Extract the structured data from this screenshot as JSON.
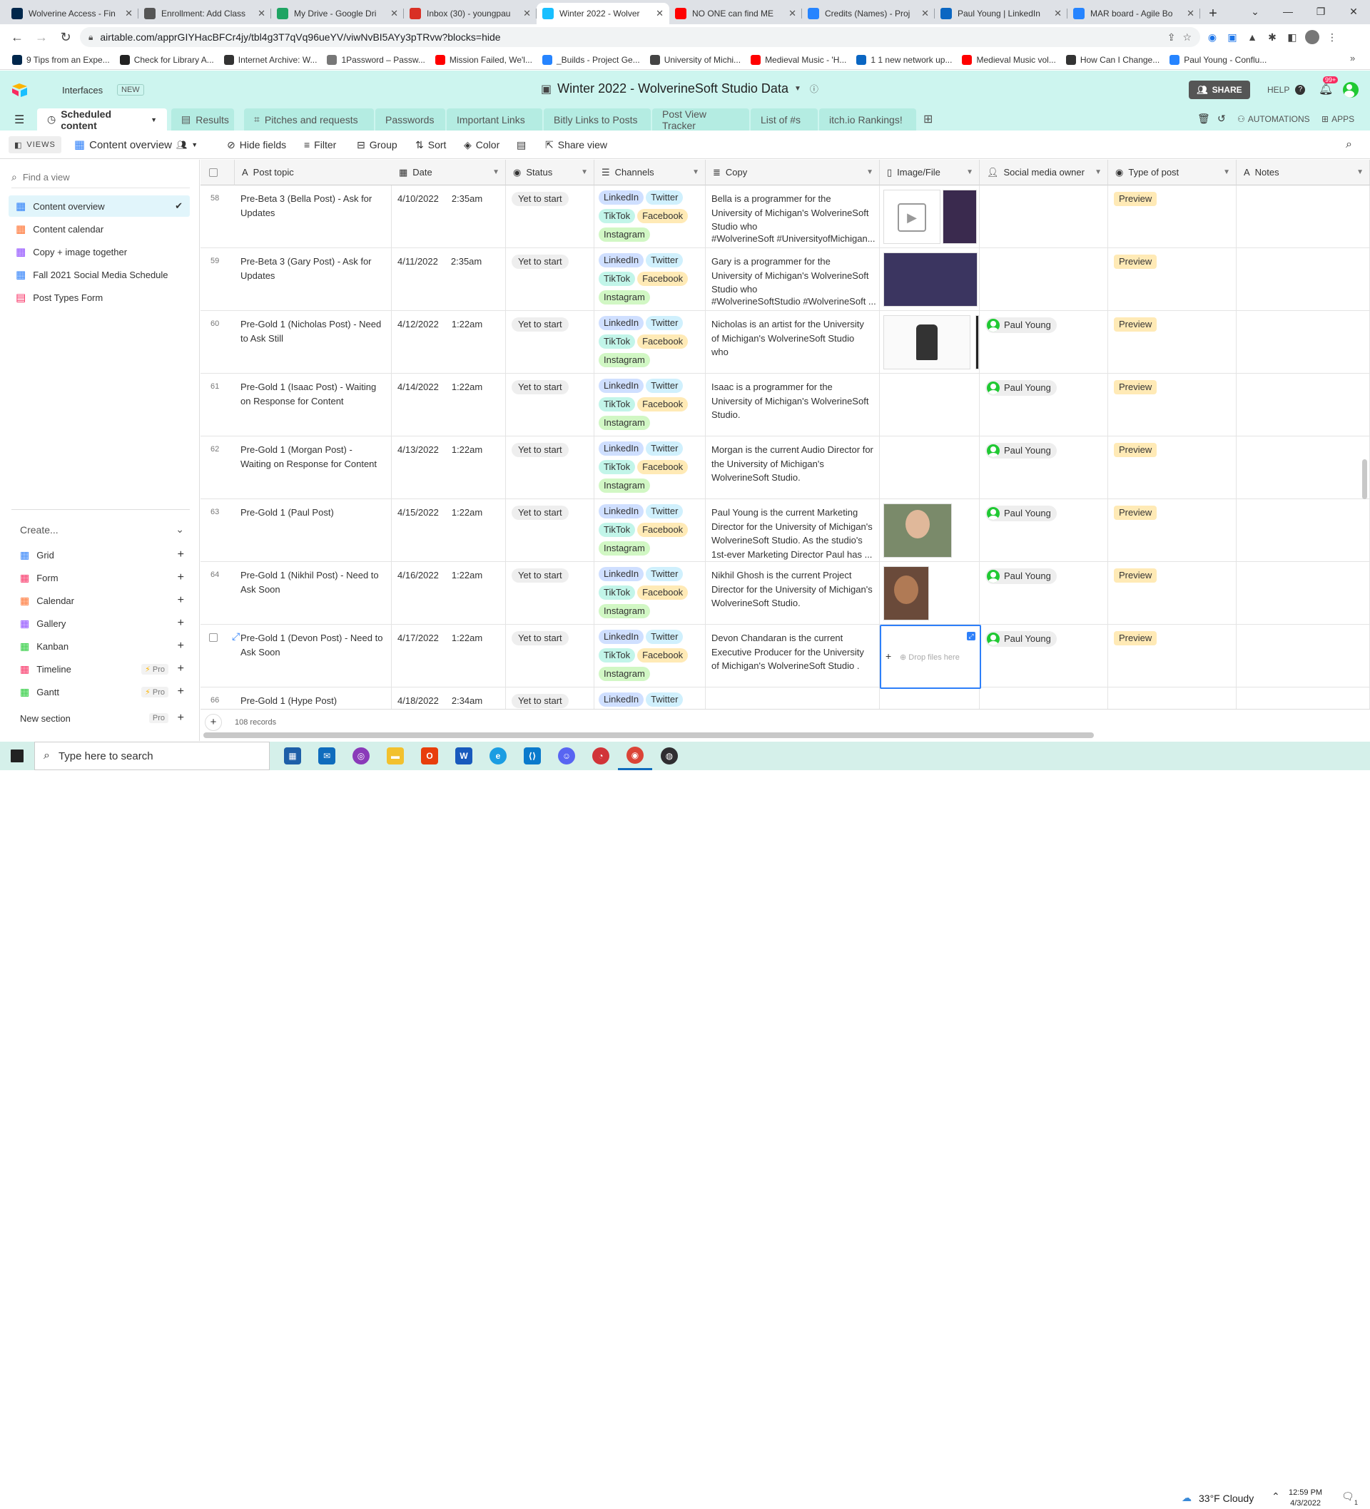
{
  "browser": {
    "tabs": [
      {
        "title": "Wolverine Access - Fin",
        "icon": "michigan-icon",
        "color": "#00274c"
      },
      {
        "title": "Enrollment: Add Class",
        "icon": "globe-icon",
        "color": "#555555"
      },
      {
        "title": "My Drive - Google Dri",
        "icon": "drive-icon",
        "color": "#1fa463"
      },
      {
        "title": "Inbox (30) - youngpau",
        "icon": "gmail-icon",
        "color": "#d93025"
      },
      {
        "title": "Winter 2022 - Wolver",
        "icon": "airtable-icon",
        "color": "#18bfff"
      },
      {
        "title": "NO ONE can find ME",
        "icon": "youtube-icon",
        "color": "#ff0000"
      },
      {
        "title": "Credits (Names) - Proj",
        "icon": "confluence-icon",
        "color": "#2684ff"
      },
      {
        "title": "Paul Young | LinkedIn",
        "icon": "linkedin-icon",
        "color": "#0a66c2"
      },
      {
        "title": "MAR board - Agile Bo",
        "icon": "jira-icon",
        "color": "#2684ff"
      }
    ],
    "url": "airtable.com/apprGIYHacBFCr4jy/tbl4g3T7qVq96ueYV/viwNvBI5AYy3pTRvw?blocks=hide",
    "bookmarks": [
      {
        "label": "9 Tips from an Expe...",
        "icon": "michigan-icon",
        "color": "#00274c"
      },
      {
        "label": "Check for Library A...",
        "icon": "library-icon",
        "color": "#222222"
      },
      {
        "label": "Internet Archive: W...",
        "icon": "archive-icon",
        "color": "#333333"
      },
      {
        "label": "1Password – Passw...",
        "icon": "1password-icon",
        "color": "#777777"
      },
      {
        "label": "Mission Failed, We'l...",
        "icon": "youtube-icon",
        "color": "#ff0000"
      },
      {
        "label": "_Builds - Project Ge...",
        "icon": "confluence-icon",
        "color": "#2684ff"
      },
      {
        "label": "University of Michi...",
        "icon": "shield-icon",
        "color": "#444444"
      },
      {
        "label": "Medieval Music - 'H...",
        "icon": "youtube-icon",
        "color": "#ff0000"
      },
      {
        "label": "1 1 new network up...",
        "icon": "linkedin-icon",
        "color": "#0a66c2"
      },
      {
        "label": "Medieval Music vol...",
        "icon": "youtube-icon",
        "color": "#ff0000"
      },
      {
        "label": "How Can I Change...",
        "icon": "w-icon",
        "color": "#333333"
      },
      {
        "label": "Paul Young - Conflu...",
        "icon": "confluence-icon",
        "color": "#2684ff"
      }
    ]
  },
  "airtable": {
    "interfaces": "Interfaces",
    "new_badge": "NEW",
    "base_title": "Winter 2022 - WolverineSoft Studio Data",
    "share": "SHARE",
    "help": "HELP",
    "notif_count": "99+",
    "automations": "AUTOMATIONS",
    "apps": "APPS",
    "table_tabs": [
      "Scheduled content",
      "Results",
      "Pitches and requests",
      "Passwords",
      "Important Links",
      "Bitly Links to Posts",
      "Post View Tracker",
      "List of #s",
      "itch.io Rankings!"
    ],
    "views_btn": "VIEWS",
    "current_view": "Content overview",
    "toolbar": {
      "hide": "Hide fields",
      "filter": "Filter",
      "group": "Group",
      "sort": "Sort",
      "color": "Color",
      "share": "Share view"
    }
  },
  "sidebar": {
    "find_placeholder": "Find a view",
    "views": [
      {
        "label": "Content overview",
        "icon": "grid-icon"
      },
      {
        "label": "Content calendar",
        "icon": "calendar-icon"
      },
      {
        "label": "Copy + image together",
        "icon": "gallery-icon"
      },
      {
        "label": "Fall 2021 Social Media Schedule",
        "icon": "grid-icon"
      },
      {
        "label": "Post Types Form",
        "icon": "form-icon"
      }
    ],
    "create": "Create...",
    "create_items": [
      {
        "label": "Grid",
        "color": "#2d7ff9",
        "pro": ""
      },
      {
        "label": "Form",
        "color": "#f82b60",
        "pro": ""
      },
      {
        "label": "Calendar",
        "color": "#ff6f2c",
        "pro": ""
      },
      {
        "label": "Gallery",
        "color": "#8b46ff",
        "pro": ""
      },
      {
        "label": "Kanban",
        "color": "#20c933",
        "pro": ""
      },
      {
        "label": "Timeline",
        "color": "#f82b60",
        "pro": "Pro"
      },
      {
        "label": "Gantt",
        "color": "#20c933",
        "pro": "Pro"
      }
    ],
    "new_section": "New section",
    "new_section_pro": "Pro"
  },
  "grid": {
    "columns": [
      "Post topic",
      "Date",
      "Status",
      "Channels",
      "Copy",
      "Image/File",
      "Social media owner",
      "Type of post",
      "Notes"
    ],
    "rows": [
      {
        "num": "58",
        "topic": "Pre-Beta 3 (Bella Post) - Ask for Updates",
        "date": "4/10/2022",
        "time": "2:35am",
        "status": "Yet to start",
        "copy": "Bella is a programmer for the University of Michigan's WolverineSoft Studio who",
        "copy2": "#WolverineSoft #UniversityofMichigan...",
        "owner": "",
        "type": "Preview"
      },
      {
        "num": "59",
        "topic": "Pre-Beta 3 (Gary Post) - Ask for Updates",
        "date": "4/11/2022",
        "time": "2:35am",
        "status": "Yet to start",
        "copy": "Gary is a programmer for the University of Michigan's WolverineSoft Studio who",
        "copy2": "#WolverineSoftStudio #WolverineSoft ...",
        "owner": "",
        "type": "Preview"
      },
      {
        "num": "60",
        "topic": "Pre-Gold 1 (Nicholas Post) - Need to Ask Still",
        "date": "4/12/2022",
        "time": "1:22am",
        "status": "Yet to start",
        "copy": "Nicholas is an artist for the University of Michigan's WolverineSoft Studio who",
        "copy2": "",
        "owner": "Paul Young",
        "type": "Preview"
      },
      {
        "num": "61",
        "topic": "Pre-Gold 1 (Isaac Post) - Waiting on Response for Content",
        "date": "4/14/2022",
        "time": "1:22am",
        "status": "Yet to start",
        "copy": "Isaac is a programmer for the University of Michigan's WolverineSoft Studio.",
        "copy2": "",
        "owner": "Paul Young",
        "type": "Preview"
      },
      {
        "num": "62",
        "topic": "Pre-Gold 1 (Morgan Post) - Waiting on Response for Content",
        "date": "4/13/2022",
        "time": "1:22am",
        "status": "Yet to start",
        "copy": "Morgan is the current Audio Director for the University of Michigan's WolverineSoft Studio.",
        "copy2": "",
        "owner": "Paul Young",
        "type": "Preview"
      },
      {
        "num": "63",
        "topic": "Pre-Gold 1 (Paul Post)",
        "date": "4/15/2022",
        "time": "1:22am",
        "status": "Yet to start",
        "copy": "Paul Young is the current Marketing Director for the University of Michigan's WolverineSoft Studio. As the studio's 1st-ever Marketing Director Paul has ...",
        "copy2": "",
        "owner": "Paul Young",
        "type": "Preview"
      },
      {
        "num": "64",
        "topic": "Pre-Gold 1 (Nikhil Post) - Need to Ask Soon",
        "date": "4/16/2022",
        "time": "1:22am",
        "status": "Yet to start",
        "copy": "Nikhil Ghosh is the current Project Director for the University of Michigan's WolverineSoft Studio.",
        "copy2": "",
        "owner": "Paul Young",
        "type": "Preview"
      },
      {
        "num": "",
        "topic": "Pre-Gold 1 (Devon Post) - Need to Ask Soon",
        "date": "4/17/2022",
        "time": "1:22am",
        "status": "Yet to start",
        "copy": "Devon Chandaran is the current Executive Producer for the University of Michigan's WolverineSoft Studio .",
        "copy2": "",
        "owner": "Paul Young",
        "type": "Preview"
      },
      {
        "num": "66",
        "topic": "Pre-Gold 1 (Hype Post)",
        "date": "4/18/2022",
        "time": "2:34am",
        "status": "Yet to start",
        "copy": "",
        "copy2": "",
        "owner": "",
        "type": ""
      }
    ],
    "channels": [
      "LinkedIn",
      "Twitter",
      "TikTok",
      "Facebook",
      "Instagram"
    ],
    "drop_files": "Drop files here",
    "records": "108 records"
  },
  "taskbar": {
    "search_placeholder": "Type here to search",
    "weather": "33°F  Cloudy",
    "time": "12:59 PM",
    "date": "4/3/2022",
    "notif": "1"
  }
}
